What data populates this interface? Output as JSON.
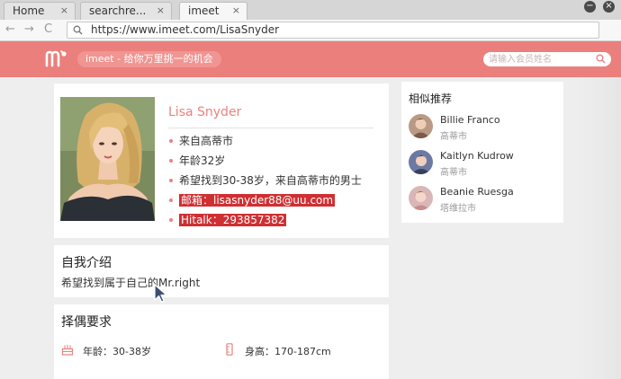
{
  "browser": {
    "tabs": [
      {
        "label": "Home",
        "close": "×"
      },
      {
        "label": "searchre...",
        "close": "×"
      },
      {
        "label": "imeet",
        "close": "×"
      }
    ],
    "url": "https://www.imeet.com/LisaSnyder",
    "nav": {
      "back": "←",
      "forward": "→",
      "reload": "C"
    },
    "window_controls": {
      "minimize": "−",
      "close": "×"
    }
  },
  "site": {
    "logo_icon": "imeet-m-logo",
    "slogan": "imeet - 给你万里挑一的机会",
    "search_placeholder": "请输入会员姓名",
    "accent_color": "#eb7f7b"
  },
  "profile": {
    "name": "Lisa Snyder",
    "details": [
      "来自高蒂市",
      "年龄32岁",
      "希望找到30-38岁，来自高蒂市的男士"
    ],
    "email": "邮箱：lisasnyder88@uu.com",
    "hitalk": "Hitalk：293857382",
    "highlight_color": "#cf2f32"
  },
  "intro": {
    "title": "自我介绍",
    "text": "希望找到属于自己的Mr.right"
  },
  "requirements": {
    "title": "择偶要求",
    "age": "年龄：30-38岁",
    "height": "身高：170-187cm"
  },
  "similar": {
    "title": "相似推荐",
    "items": [
      {
        "name": "Billie Franco",
        "city": "高蒂市"
      },
      {
        "name": "Kaitlyn Kudrow",
        "city": "高蒂市"
      },
      {
        "name": "Beanie Ruesga",
        "city": "塔维拉市"
      }
    ]
  }
}
